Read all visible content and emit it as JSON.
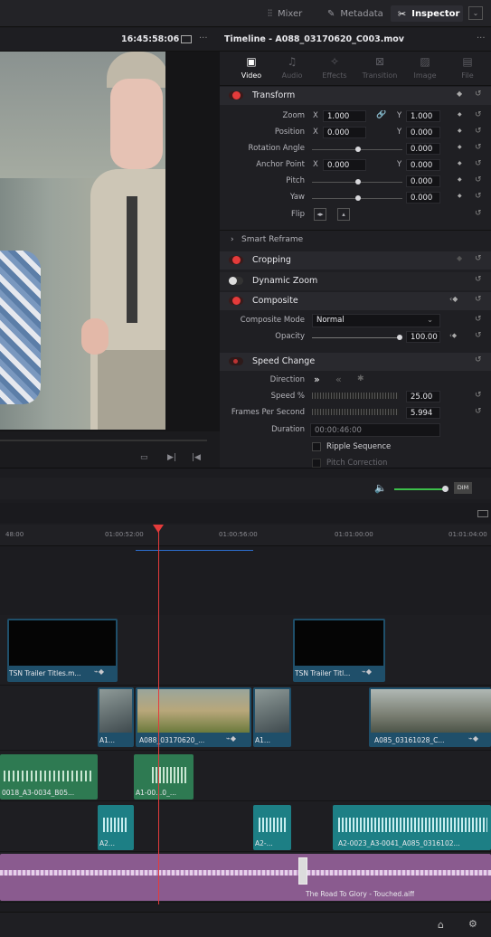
{
  "topbar": {
    "mixer": "Mixer",
    "metadata": "Metadata",
    "inspector": "Inspector"
  },
  "viewer": {
    "timecode": "16:45:58:06",
    "more": "···"
  },
  "inspector": {
    "title": "Timeline - A088_03170620_C003.mov",
    "more": "···",
    "tabs": [
      {
        "label": "Video",
        "icon": "video-icon"
      },
      {
        "label": "Audio",
        "icon": "audio-icon"
      },
      {
        "label": "Effects",
        "icon": "effects-icon"
      },
      {
        "label": "Transition",
        "icon": "transition-icon"
      },
      {
        "label": "Image",
        "icon": "image-icon"
      },
      {
        "label": "File",
        "icon": "file-icon"
      }
    ],
    "transform": {
      "title": "Transform",
      "zoom_label": "Zoom",
      "zoom_x": "1.000",
      "zoom_y": "1.000",
      "position_label": "Position",
      "position_x": "0.000",
      "position_y": "0.000",
      "rotation_label": "Rotation Angle",
      "rotation": "0.000",
      "anchor_label": "Anchor Point",
      "anchor_x": "0.000",
      "anchor_y": "0.000",
      "pitch_label": "Pitch",
      "pitch": "0.000",
      "yaw_label": "Yaw",
      "yaw": "0.000",
      "flip_label": "Flip",
      "x": "X",
      "y": "Y"
    },
    "smart_reframe": "Smart Reframe",
    "cropping": "Cropping",
    "dynamic_zoom": "Dynamic Zoom",
    "composite": {
      "title": "Composite",
      "mode_label": "Composite Mode",
      "mode_value": "Normal",
      "opacity_label": "Opacity",
      "opacity": "100.00"
    },
    "speed": {
      "title": "Speed Change",
      "direction_label": "Direction",
      "speed_label": "Speed %",
      "speed": "25.00",
      "fps_label": "Frames Per Second",
      "fps": "5.994",
      "duration_label": "Duration",
      "duration": "00:00:46:00",
      "ripple": "Ripple Sequence",
      "pitch_correction": "Pitch Correction"
    }
  },
  "audio_meter": {
    "dim": "DIM"
  },
  "timeline": {
    "ruler": [
      "48:00",
      "01:00:52:00",
      "01:00:56:00",
      "01:01:00:00",
      "01:01:04:00"
    ],
    "clips": {
      "title1": "TSN Trailer Titles.m...",
      "title2": "TSN Trailer Titl...",
      "v_a1_left": "A1...",
      "v_main": "A088_03170620_...",
      "v_a1_right": "A1...",
      "v_right": "A085_03161028_C...",
      "a1_left": "0018_A3-0034_B05...",
      "a1_mid": "A1-00...0_...",
      "a2_left": "A2...",
      "a2_mid": "A2-...",
      "a2_right": "A2-0023_A3-0041_A085_0316102...",
      "music": "The Road To Glory - Touched.aiff"
    }
  },
  "colors": {
    "accent_red": "#e43b3b",
    "video_clip": "#1f4f6a",
    "audio_green": "#2e7a52",
    "audio_teal": "#1d7f85",
    "music_purple": "#8a5b8f"
  }
}
